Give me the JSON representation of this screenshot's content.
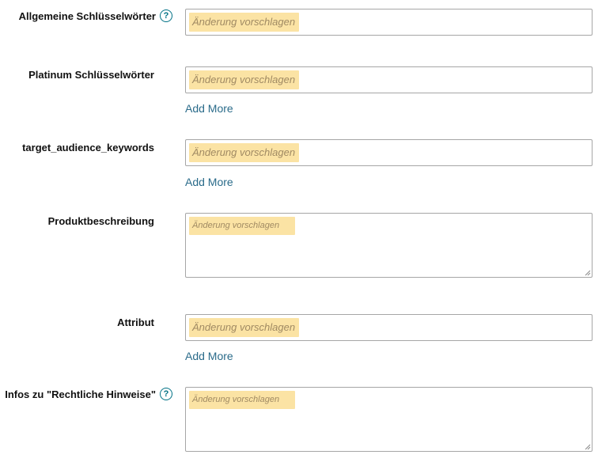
{
  "fields": {
    "general_keywords": {
      "label": "Allgemeine Schlüsselwörter",
      "help": "?",
      "suggestion": "Änderung vorschlagen"
    },
    "platinum_keywords": {
      "label": "Platinum Schlüsselwörter",
      "suggestion": "Änderung vorschlagen",
      "add_more": "Add More"
    },
    "target_audience_keywords": {
      "label": "target_audience_keywords",
      "suggestion": "Änderung vorschlagen",
      "add_more": "Add More"
    },
    "product_description": {
      "label": "Produktbeschreibung",
      "suggestion": "Änderung vorschlagen"
    },
    "attribute": {
      "label": "Attribut",
      "suggestion": "Änderung vorschlagen",
      "add_more": "Add More"
    },
    "legal_notices": {
      "label": "Infos zu \"Rechtliche Hinweise\"",
      "help": "?",
      "suggestion": "Änderung vorschlagen"
    }
  },
  "colors": {
    "link": "#2a6b8a",
    "help_icon": "#007185",
    "suggestion_bg": "#fbe3a4",
    "suggestion_text": "#a08a63",
    "field_border": "#a6a6a6"
  },
  "icons": {
    "help": "help-circle-icon",
    "resize": "resize-grip-icon"
  }
}
